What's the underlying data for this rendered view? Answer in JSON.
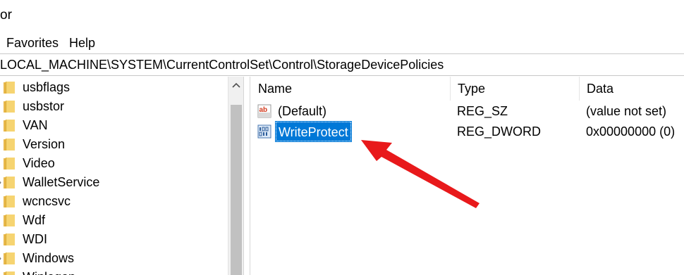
{
  "window": {
    "title_fragment": "or"
  },
  "menu": {
    "favorites": "Favorites",
    "help": "Help"
  },
  "address": {
    "path": "LOCAL_MACHINE\\SYSTEM\\CurrentControlSet\\Control\\StorageDevicePolicies"
  },
  "tree": {
    "items": [
      {
        "label": "usbflags"
      },
      {
        "label": "usbstor"
      },
      {
        "label": "VAN"
      },
      {
        "label": "Version"
      },
      {
        "label": "Video"
      },
      {
        "label": "WalletService"
      },
      {
        "label": "wcncsvc"
      },
      {
        "label": "Wdf"
      },
      {
        "label": "WDI"
      },
      {
        "label": "Windows"
      },
      {
        "label": "Winlogon"
      }
    ]
  },
  "list": {
    "headers": {
      "name": "Name",
      "type": "Type",
      "data": "Data"
    },
    "rows": [
      {
        "name": "(Default)",
        "type": "REG_SZ",
        "data": "(value not set)",
        "icon": "reg-string-icon",
        "selected": false
      },
      {
        "name": "WriteProtect",
        "type": "REG_DWORD",
        "data": "0x00000000 (0)",
        "icon": "reg-binary-icon",
        "selected": true
      }
    ]
  },
  "annotation": {
    "color": "#e8191b",
    "shape": "pointer-arrow"
  },
  "colors": {
    "selection": "#0078d7",
    "folder": "#f6d471"
  }
}
